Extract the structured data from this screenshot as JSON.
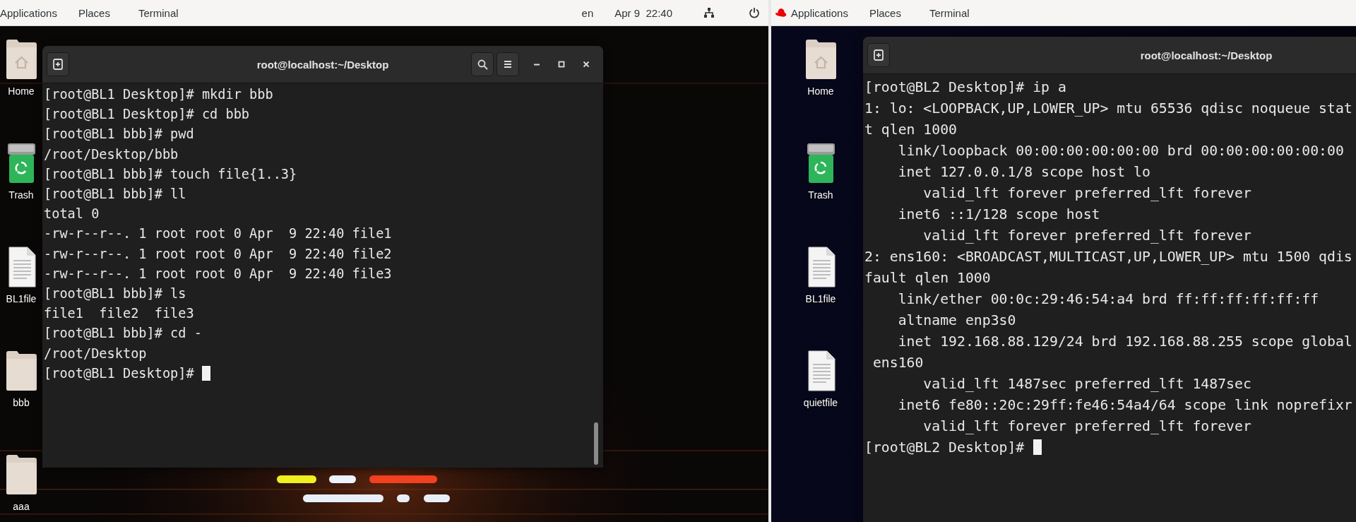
{
  "screens": [
    {
      "top_bar": {
        "logo": false,
        "menus": [
          "Applications",
          "Places",
          "Terminal"
        ],
        "language": "en",
        "clock": "Apr 9  22:40"
      },
      "wallpaper": {
        "kind": "picture"
      },
      "desktop_icons": [
        {
          "label": "Home",
          "kind": "home"
        },
        {
          "label": "Trash",
          "kind": "trash"
        },
        {
          "label": "BL1file",
          "kind": "file"
        },
        {
          "label": "bbb",
          "kind": "folder"
        },
        {
          "label": "aaa",
          "kind": "folder"
        }
      ],
      "terminal": {
        "title": "root@localhost:~/Desktop",
        "scrollbar": true,
        "buttons": [
          {
            "kind": "new-tab"
          },
          {
            "kind": "search"
          },
          {
            "kind": "menu"
          },
          {
            "kind": "minimize"
          },
          {
            "kind": "maximize"
          },
          {
            "kind": "close"
          }
        ],
        "lines": [
          "[root@BL1 Desktop]# mkdir bbb",
          "[root@BL1 Desktop]# cd bbb",
          "[root@BL1 bbb]# pwd",
          "/root/Desktop/bbb",
          "[root@BL1 bbb]# touch file{1..3}",
          "[root@BL1 bbb]# ll",
          "total 0",
          "-rw-r--r--. 1 root root 0 Apr  9 22:40 file1",
          "-rw-r--r--. 1 root root 0 Apr  9 22:40 file2",
          "-rw-r--r--. 1 root root 0 Apr  9 22:40 file3",
          "[root@BL1 bbb]# ls",
          "file1  file2  file3",
          "[root@BL1 bbb]# cd -",
          "/root/Desktop",
          "[root@BL1 Desktop]#"
        ]
      }
    },
    {
      "top_bar": {
        "logo": true,
        "menus": [
          "Applications",
          "Places",
          "Terminal"
        ]
      },
      "wallpaper": {
        "kind": "plain"
      },
      "desktop_icons": [
        {
          "label": "Home",
          "kind": "home"
        },
        {
          "label": "Trash",
          "kind": "trash"
        },
        {
          "label": "BL1file",
          "kind": "file"
        },
        {
          "label": "quietfile",
          "kind": "file"
        }
      ],
      "terminal": {
        "title": "root@localhost:~/Desktop",
        "scrollbar": false,
        "buttons": [
          {
            "kind": "new-tab"
          }
        ],
        "lines": [
          "[root@BL2 Desktop]# ip a",
          "1: lo: <LOOPBACK,UP,LOWER_UP> mtu 65536 qdisc noqueue stat",
          "t qlen 1000",
          "    link/loopback 00:00:00:00:00:00 brd 00:00:00:00:00:00",
          "    inet 127.0.0.1/8 scope host lo",
          "       valid_lft forever preferred_lft forever",
          "    inet6 ::1/128 scope host",
          "       valid_lft forever preferred_lft forever",
          "2: ens160: <BROADCAST,MULTICAST,UP,LOWER_UP> mtu 1500 qdis",
          "fault qlen 1000",
          "    link/ether 00:0c:29:46:54:a4 brd ff:ff:ff:ff:ff:ff",
          "    altname enp3s0",
          "    inet 192.168.88.129/24 brd 192.168.88.255 scope global",
          " ens160",
          "       valid_lft 1487sec preferred_lft 1487sec",
          "    inet6 fe80::20c:29ff:fe46:54a4/64 scope link noprefixr",
          "       valid_lft forever preferred_lft forever",
          "[root@BL2 Desktop]#"
        ]
      }
    }
  ]
}
